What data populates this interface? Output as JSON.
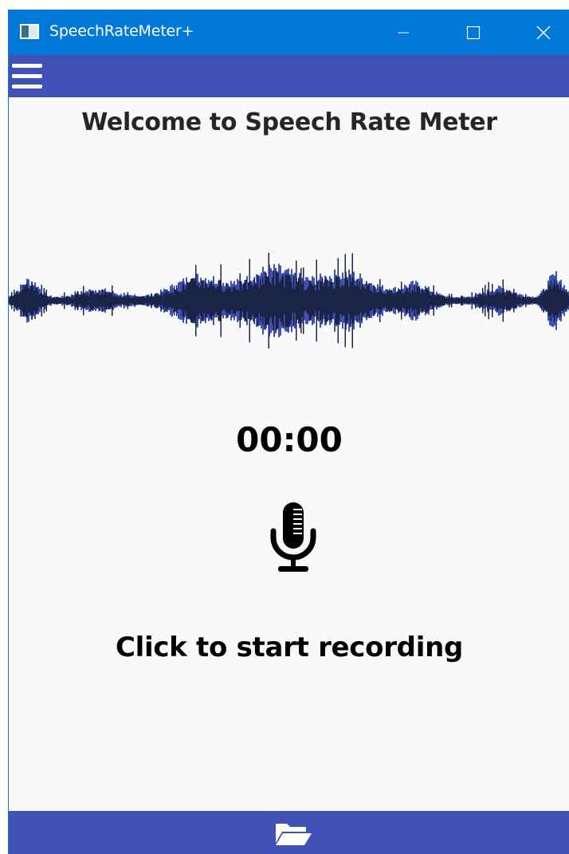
{
  "window": {
    "title": "SpeechRateMeter+"
  },
  "toolbar": {
    "menu_icon": "hamburger-menu-icon"
  },
  "main": {
    "welcome_text": "Welcome to Speech Rate Meter",
    "timer": "00:00",
    "mic_icon": "microphone-icon",
    "prompt": "Click to start recording"
  },
  "footer": {
    "folder_icon": "open-folder-icon"
  },
  "colors": {
    "titlebar": "#0078d7",
    "appbar": "#3f51b5",
    "waveform_dark": "#1b2346",
    "waveform_light": "#3f51b5"
  }
}
